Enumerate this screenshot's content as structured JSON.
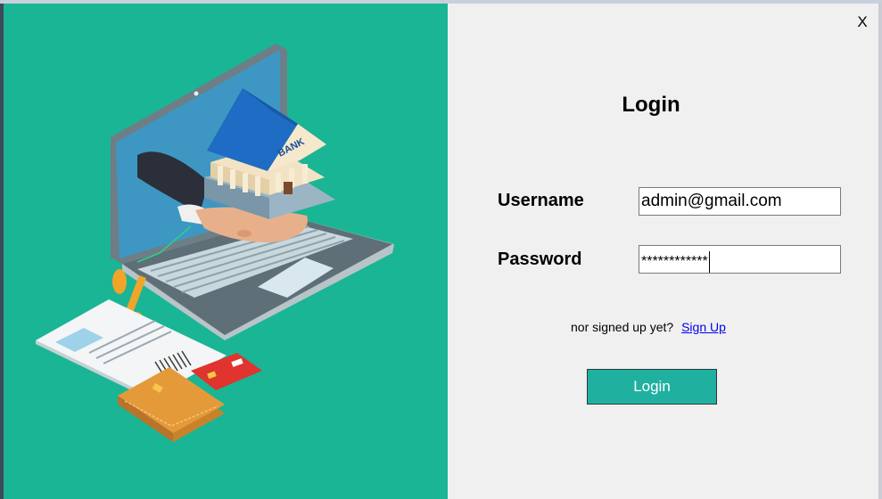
{
  "window": {
    "close_label": "X"
  },
  "form": {
    "title": "Login",
    "username_label": "Username",
    "username_value": "admin@gmail.com",
    "password_label": "Password",
    "password_value": "************",
    "signup_prompt": "nor signed up yet?",
    "signup_link": "Sign Up",
    "login_button": "Login"
  },
  "illustration": {
    "bank_sign": "BANK",
    "colors": {
      "panel_background": "#1ab595",
      "button": "#20b0a0",
      "link": "#0000ee"
    }
  }
}
